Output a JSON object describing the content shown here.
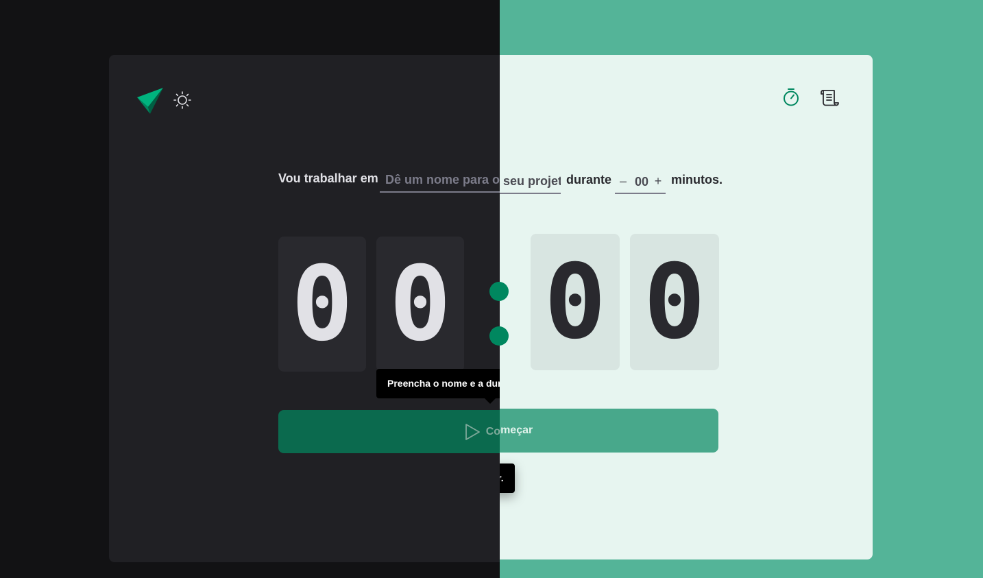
{
  "header": {
    "logo_icon": "ignite-paper-plane-logo-icon",
    "theme_toggle_icon": "sun-icon",
    "nav": [
      {
        "icon": "timer-icon",
        "name": "timer"
      },
      {
        "icon": "scroll-history-icon",
        "name": "history"
      }
    ]
  },
  "form": {
    "task_label": "Vou trabalhar em",
    "task_placeholder": "Dê um nome para o seu projeto",
    "duration_label": "durante",
    "minus_label": "–",
    "plus_label": "+",
    "minutes_value": "00",
    "minutes_suffix": "minutos."
  },
  "countdown": {
    "minutes_tens": "0",
    "minutes_ones": "0",
    "seconds_tens": "0",
    "seconds_ones": "0"
  },
  "start_button": {
    "label": "Começar",
    "icon": "play-icon"
  },
  "tooltip": {
    "text": "Preencha o nome e a duração antes de começar."
  },
  "colors": {
    "green_accent": "#00875f",
    "light_background": "#54b498",
    "dark_background": "#121214"
  }
}
